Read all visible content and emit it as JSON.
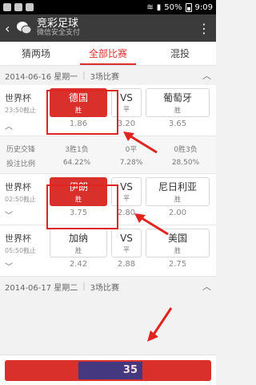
{
  "status": {
    "battery": "50%",
    "time": "9:09"
  },
  "appbar": {
    "back_icon": "back-chevron-icon",
    "title": "竞彩足球",
    "subtitle": "微信安全支付",
    "more_icon": "more-dots-icon"
  },
  "tabs": [
    {
      "label": "猜两场"
    },
    {
      "label": "全部比赛"
    },
    {
      "label": "混投"
    }
  ],
  "day1": {
    "date": "2014-06-16 星期一",
    "count": "3场比赛"
  },
  "day2": {
    "date": "2014-06-17 星期二",
    "count": "3场比赛"
  },
  "matches": [
    {
      "league": "世界杯",
      "time": "23:50截止",
      "home": "德国",
      "vs": "VS",
      "away": "葡萄牙",
      "home_res": "胜",
      "vs_res": "平",
      "away_res": "胜",
      "odds": [
        "1.86",
        "3.20",
        "3.65"
      ]
    },
    {
      "league": "世界杯",
      "time": "02:50截止",
      "home": "伊朗",
      "vs": "VS",
      "away": "尼日利亚",
      "home_res": "胜",
      "vs_res": "平",
      "away_res": "胜",
      "odds": [
        "3.75",
        "2.80",
        "2.00"
      ]
    },
    {
      "league": "世界杯",
      "time": "05:50截止",
      "home": "加纳",
      "vs": "VS",
      "away": "美国",
      "home_res": "胜",
      "vs_res": "平",
      "away_res": "胜",
      "odds": [
        "2.42",
        "2.88",
        "2.75"
      ]
    }
  ],
  "stats": {
    "history_label": "历史交锋",
    "history": [
      "3胜1负",
      "0平",
      "0胜3负"
    ],
    "bet_label": "投注比例",
    "bet": [
      "64.22%",
      "7.28%",
      "28.50%"
    ]
  },
  "watermark": "35"
}
